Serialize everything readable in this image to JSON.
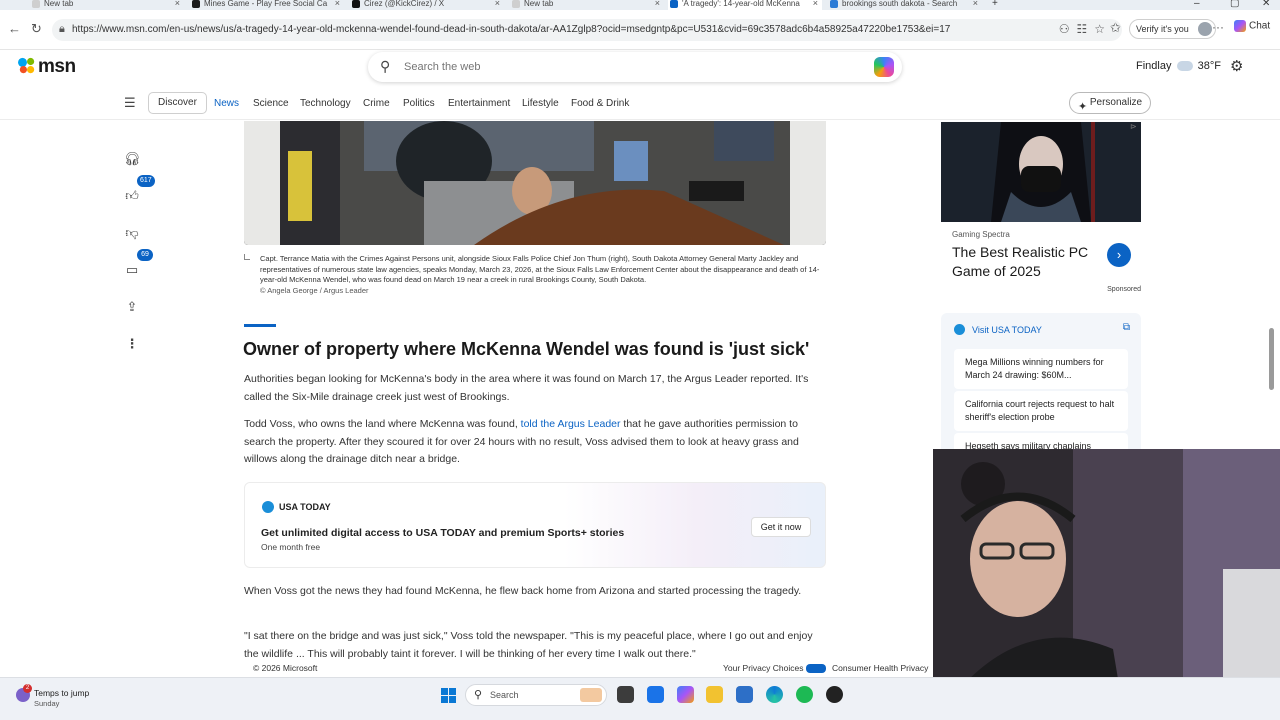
{
  "browser": {
    "tabs": [
      {
        "title": "New tab",
        "color": "#8a8a8a"
      },
      {
        "title": "Mines Game - Play Free Social Ca",
        "color": "#1a1a1a"
      },
      {
        "title": "Cirez (@KickCirez) / X",
        "color": "#111111"
      },
      {
        "title": "New tab",
        "color": "#8a8a8a"
      },
      {
        "title": "'A tragedy': 14-year-old McKenna",
        "color": "#0b63c4"
      },
      {
        "title": "brookings south dakota - Search",
        "color": "#2b7bd6"
      }
    ],
    "url": "https://www.msn.com/en-us/news/us/a-tragedy-14-year-old-mckenna-wendel-found-dead-in-south-dakota/ar-AA1Zglp8?ocid=msedgntp&pc=U531&cvid=69c3578adc6b4a58925a47220be1753&ei=17",
    "verify_label": "Verify it's you",
    "copilot_label": "Chat"
  },
  "header": {
    "logo_text": "msn",
    "search_placeholder": "Search the web",
    "weather_city": "Findlay",
    "weather_temp": "38°F"
  },
  "nav": {
    "discover": "Discover",
    "items": [
      "News",
      "Science",
      "Technology",
      "Crime",
      "Politics",
      "Entertainment",
      "Lifestyle",
      "Food & Drink"
    ],
    "personalize": "Personalize"
  },
  "rail": {
    "like_count": "617",
    "comment_count": "69"
  },
  "article": {
    "caption": "Capt. Terrance Matia with the Crimes Against Persons unit, alongside Sioux Falls Police Chief Jon Thum (right), South Dakota Attorney General Marty Jackley and representatives of numerous state law agencies, speaks Monday, March 23, 2026, at the Sioux Falls Law Enforcement Center about the disappearance and death of 14-year-old McKenna Wendel, who was found dead on March 19 near a creek in rural Brookings County, South Dakota.",
    "credit": "© Angela George / Argus Leader",
    "heading": "Owner of property where McKenna Wendel was found is 'just sick'",
    "p1": "Authorities began looking for McKenna's body in the area where it was found on March 17, the Argus Leader reported. It's called the Six-Mile drainage creek just west of Brookings.",
    "p2_before": "Todd Voss, who owns the land where McKenna was found, ",
    "p2_link": "told the Argus Leader",
    "p2_after": " that he gave authorities permission to search the property. After they scoured it for over 24 hours with no result, Voss advised them to look at heavy grass and willows along the drainage ditch near a bridge.",
    "p3": "When Voss got the news they had found McKenna, he flew back home from Arizona and started processing the tragedy.",
    "p4": "\"I sat there on the bridge and was just sick,\" Voss told the newspaper. \"This is my peaceful place, where I go out and enjoy the wildlife ... This will probably taint it forever. I will be thinking of her every time I walk out there.\""
  },
  "promo": {
    "brand": "USA TODAY",
    "title": "Get unlimited digital access to USA TODAY and premium Sports+ stories",
    "subtitle": "One month free",
    "button": "Get it now"
  },
  "ad": {
    "source": "Gaming Spectra",
    "title": "The Best Realistic PC Game of 2025",
    "sponsored": "Sponsored"
  },
  "usatoday_card": {
    "title": "Visit USA TODAY",
    "items": [
      "Mega Millions winning numbers for March 24 drawing: $60M...",
      "California court rejects request to halt sheriff's election probe",
      "Hegseth says military chaplains"
    ]
  },
  "footer": {
    "copyright": "© 2026 Microsoft",
    "privacy": "Your Privacy Choices",
    "health": "Consumer Health Privacy"
  },
  "taskbar": {
    "weather_line1": "Temps to jump",
    "weather_line2": "Sunday",
    "weather_badge": "2",
    "search_label": "Search"
  }
}
